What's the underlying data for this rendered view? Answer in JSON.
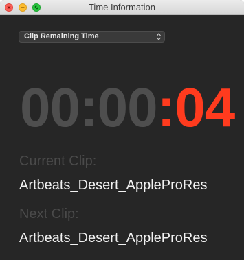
{
  "window": {
    "title": "Time Information"
  },
  "mode_select": {
    "selected": "Clip Remaining Time"
  },
  "timecode": {
    "dim_part": "00:00",
    "highlight_part": ":04"
  },
  "current_clip": {
    "label": "Current Clip:",
    "value": "Artbeats_Desert_AppleProRes"
  },
  "next_clip": {
    "label": "Next Clip:",
    "value": "Artbeats_Desert_AppleProRes"
  },
  "colors": {
    "background": "#262626",
    "timecode_dim": "#4e4e4e",
    "timecode_highlight": "#ff3b1e",
    "label_text": "#4a4a4a",
    "value_text": "#f2f2f2"
  }
}
